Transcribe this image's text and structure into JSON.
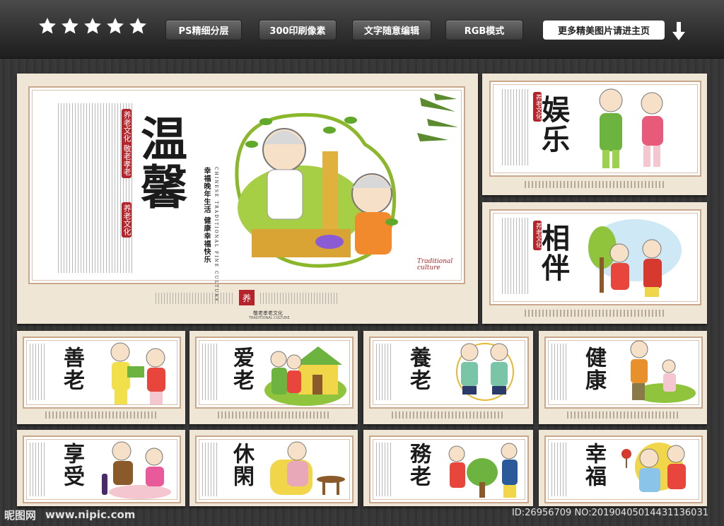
{
  "header": {
    "stars": [
      1,
      1,
      1,
      1,
      1
    ],
    "features": [
      "PS精细分层",
      "300印刷像素",
      "文字随意编辑",
      "RGB模式"
    ],
    "more_label": "更多精美图片请进主页"
  },
  "main": {
    "title": "温馨",
    "badge_top": "养老文化 敬老孝老",
    "badge_bottom": "养老文化",
    "slogan": "幸福晚年生活 健康幸福快乐",
    "english": "CHINESE TRADITIONAL FINE CULTURE",
    "corner_label": "Traditional culture",
    "seal": "养",
    "footer_caption": "敬老孝老文化",
    "footer_english": "TRADITIONAL CULTURE"
  },
  "panels": [
    {
      "title": "娱乐"
    },
    {
      "title": "相伴"
    },
    {
      "title": "善老"
    },
    {
      "title": "爱老"
    },
    {
      "title": "養老"
    },
    {
      "title": "健康"
    },
    {
      "title": "享受"
    },
    {
      "title": "休閑"
    },
    {
      "title": "務老"
    },
    {
      "title": "幸福"
    }
  ],
  "watermark": {
    "logo": "昵图网",
    "url": "www.nipic.com",
    "id": "ID:26956709 NO:20190405014431136031"
  },
  "colors": {
    "accent_red": "#b3252a",
    "board_bg": "#efe6d6",
    "frame": "#c9a78c"
  }
}
